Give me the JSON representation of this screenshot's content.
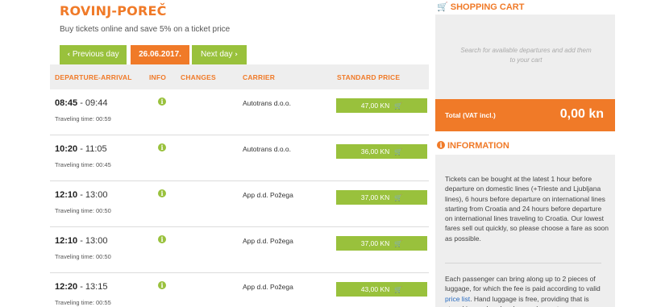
{
  "route": {
    "title": "ROVINJ-POREČ",
    "subtitle": "Buy tickets online and save 5% on a ticket price"
  },
  "day_nav": {
    "prev": "Previous day",
    "current": "26.06.2017.",
    "next": "Next day"
  },
  "table": {
    "headers": {
      "departure_arrival": "DEPARTURE-ARRIVAL",
      "info": "INFO",
      "changes": "CHANGES",
      "carrier": "CARRIER",
      "price": "STANDARD PRICE"
    },
    "rows": [
      {
        "departure": "08:45",
        "arrival": "09:44",
        "travel_time": "Traveling time: 00:59",
        "carrier": "Autotrans d.o.o.",
        "price": "47,00 KN"
      },
      {
        "departure": "10:20",
        "arrival": "11:05",
        "travel_time": "Traveling time: 00:45",
        "carrier": "Autotrans d.o.o.",
        "price": "36,00 KN"
      },
      {
        "departure": "12:10",
        "arrival": "13:00",
        "travel_time": "Traveling time: 00:50",
        "carrier": "App d.d. Požega",
        "price": "37,00 KN"
      },
      {
        "departure": "12:10",
        "arrival": "13:00",
        "travel_time": "Traveling time: 00:50",
        "carrier": "App d.d. Požega",
        "price": "37,00 KN"
      },
      {
        "departure": "12:20",
        "arrival": "13:15",
        "travel_time": "Traveling time: 00:55",
        "carrier": "App d.d. Požega",
        "price": "43,00 KN"
      }
    ]
  },
  "cart": {
    "title": "SHOPPING CART",
    "empty_text": "Search for available departures and add them to your cart",
    "total_label": "Total (VAT incl.)",
    "total_value": "0,00 kn"
  },
  "information": {
    "title": "INFORMATION",
    "paragraph1": "Tickets can be bought at the latest 1 hour before departure on domestic lines (+Trieste and Ljubljana lines), 6 hours before departure on international lines starting from Croatia and 24 hours before departure on international lines traveling to Croatia. Our lowest fares sell out quickly, so please choose a fare as soon as possible.",
    "paragraph2_before": "Each passenger can bring along up to 2 pieces of luggage, for which the fee is paid according to valid ",
    "paragraph2_link": "price list",
    "paragraph2_after": ". Hand luggage is free, providing that is stored in overhead rack or under seat."
  },
  "colors": {
    "accent": "#f07a28",
    "green": "#99c13c",
    "panel": "#eeeeee",
    "link": "#2a6cc0"
  },
  "icons": {
    "info": "info-circle-icon",
    "cart": "shopping-cart-icon",
    "chevron_left": "chevron-left-icon",
    "chevron_right": "chevron-right-icon"
  }
}
